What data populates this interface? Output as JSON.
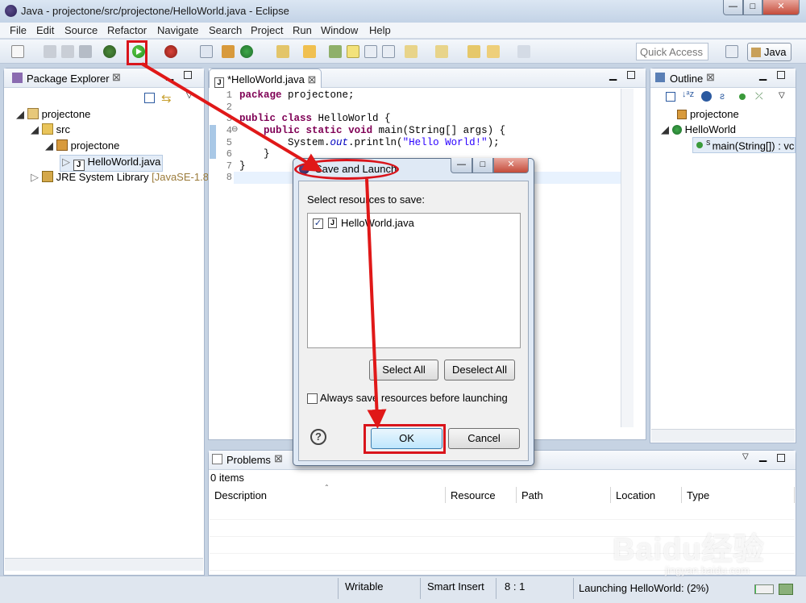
{
  "window": {
    "title": "Java - projectone/src/projectone/HelloWorld.java - Eclipse",
    "min": "—",
    "max": "□",
    "close": "✕"
  },
  "menu": [
    "File",
    "Edit",
    "Source",
    "Refactor",
    "Navigate",
    "Search",
    "Project",
    "Run",
    "Window",
    "Help"
  ],
  "toolbar": {
    "quick_access_placeholder": "Quick Access",
    "perspective": "Java"
  },
  "package_explorer": {
    "tab": "Package Explorer",
    "tree": {
      "project": "projectone",
      "src": "src",
      "package": "projectone",
      "file": "HelloWorld.java",
      "jre": "JRE System Library",
      "jre_version": "[JavaSE-1.8]"
    }
  },
  "editor": {
    "tab": "*HelloWorld.java",
    "line_numbers": [
      "1",
      "2",
      "3",
      "4",
      "5",
      "6",
      "7",
      "8"
    ],
    "lines": {
      "l1_kw": "package",
      "l1_rest": " projectone;",
      "l3_kw1": "public",
      "l3_kw2": "class",
      "l3_rest": " HelloWorld {",
      "l4_kw1": "public",
      "l4_kw2": "static",
      "l4_kw3": "void",
      "l4_rest": " main(String[] args) {",
      "l5_a": "System.",
      "l5_field": "out",
      "l5_b": ".println(",
      "l5_str": "\"Hello World!\"",
      "l5_c": ");",
      "l6": "}",
      "l7": "}"
    }
  },
  "outline": {
    "tab": "Outline",
    "package": "projectone",
    "class": "HelloWorld",
    "method": "main(String[]) : vc"
  },
  "dialog": {
    "title": "Save and Launch",
    "prompt": "Select resources to save:",
    "items": [
      {
        "label": "HelloWorld.java",
        "checked": true
      }
    ],
    "select_all": "Select All",
    "deselect_all": "Deselect All",
    "always_save": "Always save resources before launching",
    "ok": "OK",
    "cancel": "Cancel",
    "help": "?"
  },
  "problems": {
    "tab": "Problems",
    "count": "0 items",
    "columns": [
      "Description",
      "Resource",
      "Path",
      "Location",
      "Type"
    ]
  },
  "status": {
    "writable": "Writable",
    "insert": "Smart Insert",
    "position": "8 : 1",
    "launching": "Launching HelloWorld: (2%)",
    "progress_percent": 2
  },
  "watermark": {
    "brand": "Baidu经验",
    "url": "jingyan.baidu.com"
  }
}
